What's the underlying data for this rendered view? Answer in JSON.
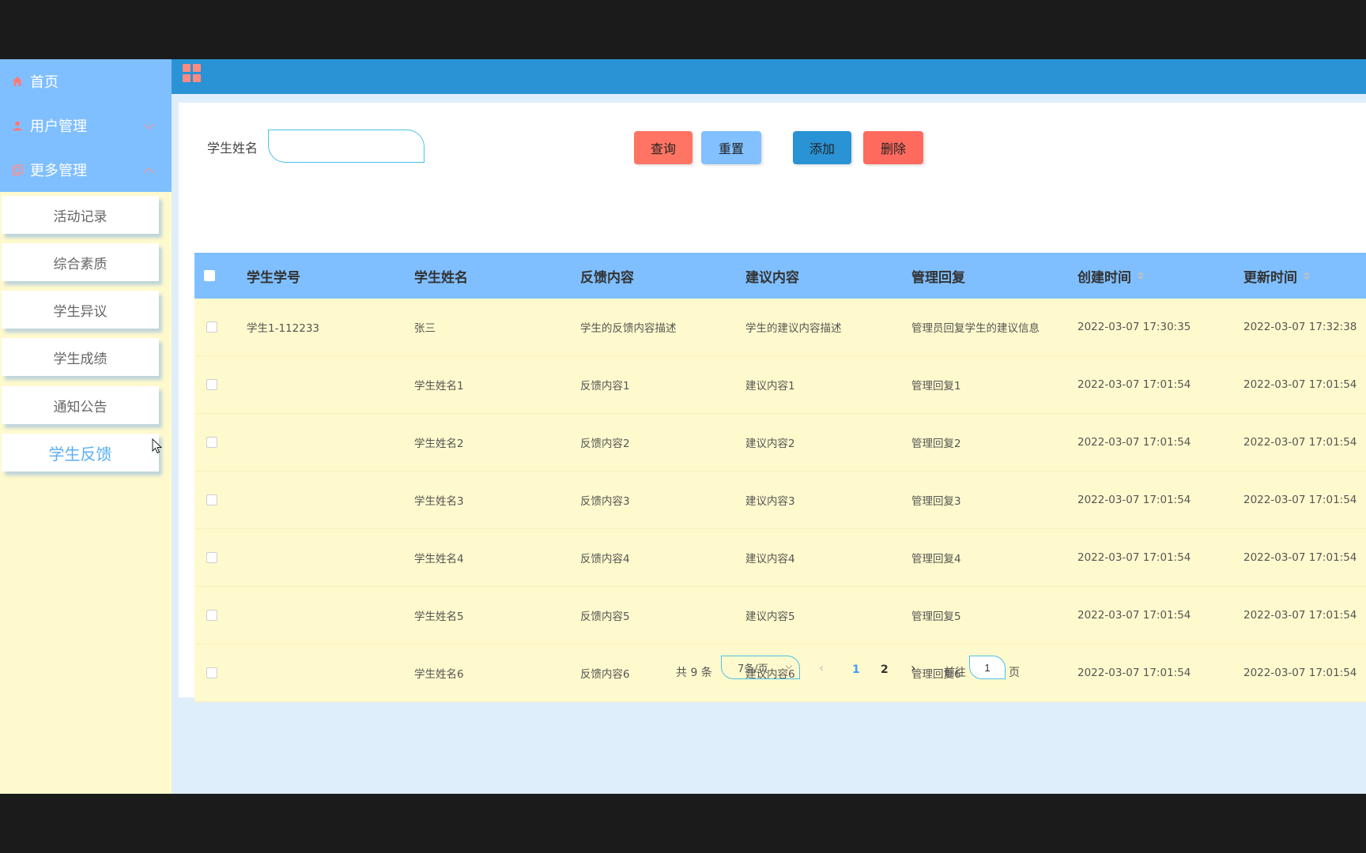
{
  "sidebar": {
    "home": "首页",
    "user_mgmt": "用户管理",
    "more_mgmt": "更多管理",
    "sub_items": [
      "活动记录",
      "综合素质",
      "学生异议",
      "学生成绩",
      "通知公告",
      "学生反馈"
    ]
  },
  "search": {
    "label": "学生姓名",
    "value": ""
  },
  "buttons": {
    "query": "查询",
    "reset": "重置",
    "add": "添加",
    "delete": "删除"
  },
  "table": {
    "headers": [
      "学生学号",
      "学生姓名",
      "反馈内容",
      "建议内容",
      "管理回复",
      "创建时间",
      "更新时间"
    ],
    "rows": [
      [
        "学生1-112233",
        "张三",
        "学生的反馈内容描述",
        "学生的建议内容描述",
        "管理员回复学生的建议信息",
        "2022-03-07 17:30:35",
        "2022-03-07 17:32:38"
      ],
      [
        "",
        "学生姓名1",
        "反馈内容1",
        "建议内容1",
        "管理回复1",
        "2022-03-07 17:01:54",
        "2022-03-07 17:01:54"
      ],
      [
        "",
        "学生姓名2",
        "反馈内容2",
        "建议内容2",
        "管理回复2",
        "2022-03-07 17:01:54",
        "2022-03-07 17:01:54"
      ],
      [
        "",
        "学生姓名3",
        "反馈内容3",
        "建议内容3",
        "管理回复3",
        "2022-03-07 17:01:54",
        "2022-03-07 17:01:54"
      ],
      [
        "",
        "学生姓名4",
        "反馈内容4",
        "建议内容4",
        "管理回复4",
        "2022-03-07 17:01:54",
        "2022-03-07 17:01:54"
      ],
      [
        "",
        "学生姓名5",
        "反馈内容5",
        "建议内容5",
        "管理回复5",
        "2022-03-07 17:01:54",
        "2022-03-07 17:01:54"
      ],
      [
        "",
        "学生姓名6",
        "反馈内容6",
        "建议内容6",
        "管理回复6",
        "2022-03-07 17:01:54",
        "2022-03-07 17:01:54"
      ]
    ]
  },
  "pagination": {
    "total": "共 9 条",
    "page_size": "7条/页",
    "pages": [
      "1",
      "2"
    ],
    "goto_label": "前往",
    "goto_value": "1",
    "page_suffix": "页"
  },
  "colors": {
    "sidebar_bg": "#fffacd",
    "menu_bg": "#7fbfff",
    "topbar_bg": "#2a93d5",
    "active_item": "#5aaef5",
    "query_button": "#ff7463",
    "delete_button": "#ff6a5e"
  }
}
